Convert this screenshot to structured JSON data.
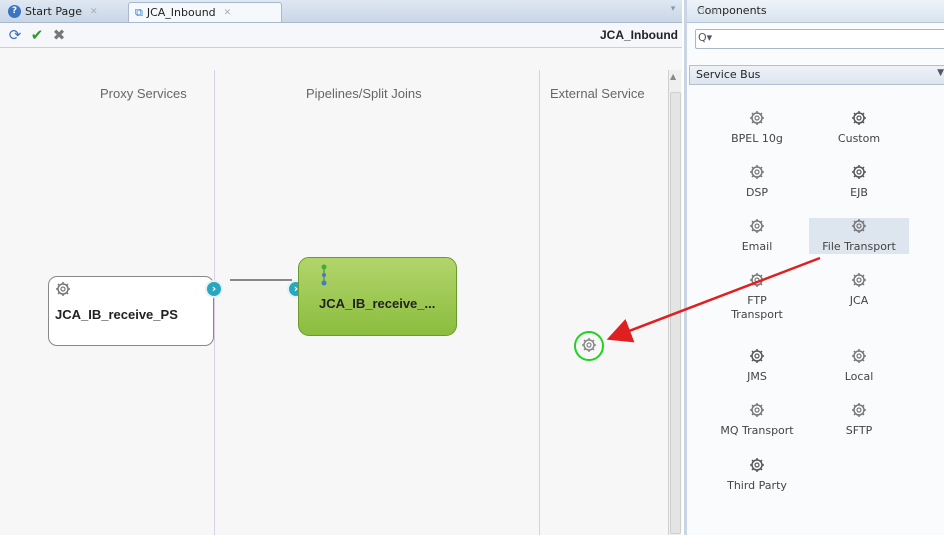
{
  "tabs": {
    "start_page": "Start Page",
    "jca_inbound": "JCA_Inbound"
  },
  "toolbar": {
    "doc_title": "JCA_Inbound"
  },
  "canvas": {
    "columns": {
      "proxy": "Proxy Services",
      "pipelines": "Pipelines/Split Joins",
      "external": "External Service"
    },
    "proxy_service": {
      "label": "JCA_IB_receive_PS"
    },
    "pipeline": {
      "label": "JCA_IB_receive_..."
    }
  },
  "panel": {
    "title": "Components",
    "search": {
      "value": ""
    },
    "category": "Service Bus",
    "components": [
      {
        "label": "BPEL 10g",
        "icon": "gear-icon"
      },
      {
        "label": "Custom",
        "icon": "custom-gear-icon"
      },
      {
        "label": "DSP",
        "icon": "gear-icon"
      },
      {
        "label": "EJB",
        "icon": "ejb-gear-icon"
      },
      {
        "label": "Email",
        "icon": "gear-icon"
      },
      {
        "label": "File Transport",
        "icon": "gear-icon",
        "selected": true
      },
      {
        "label": "FTP Transport",
        "icon": "gear-icon"
      },
      {
        "label": "JCA",
        "icon": "gear-icon"
      },
      {
        "label": "JMS",
        "icon": "jms-gear-icon"
      },
      {
        "label": "Local",
        "icon": "local-gear-icon"
      },
      {
        "label": "MQ Transport",
        "icon": "gear-icon"
      },
      {
        "label": "SFTP",
        "icon": "gear-icon"
      },
      {
        "label": "Third Party",
        "icon": "third-party-icon"
      }
    ]
  },
  "colors": {
    "pipeline_fill": "#9fcb55",
    "drag_arrow": "#e02020",
    "drop_target_ring": "#21d321",
    "port": "#2aa7c0"
  }
}
